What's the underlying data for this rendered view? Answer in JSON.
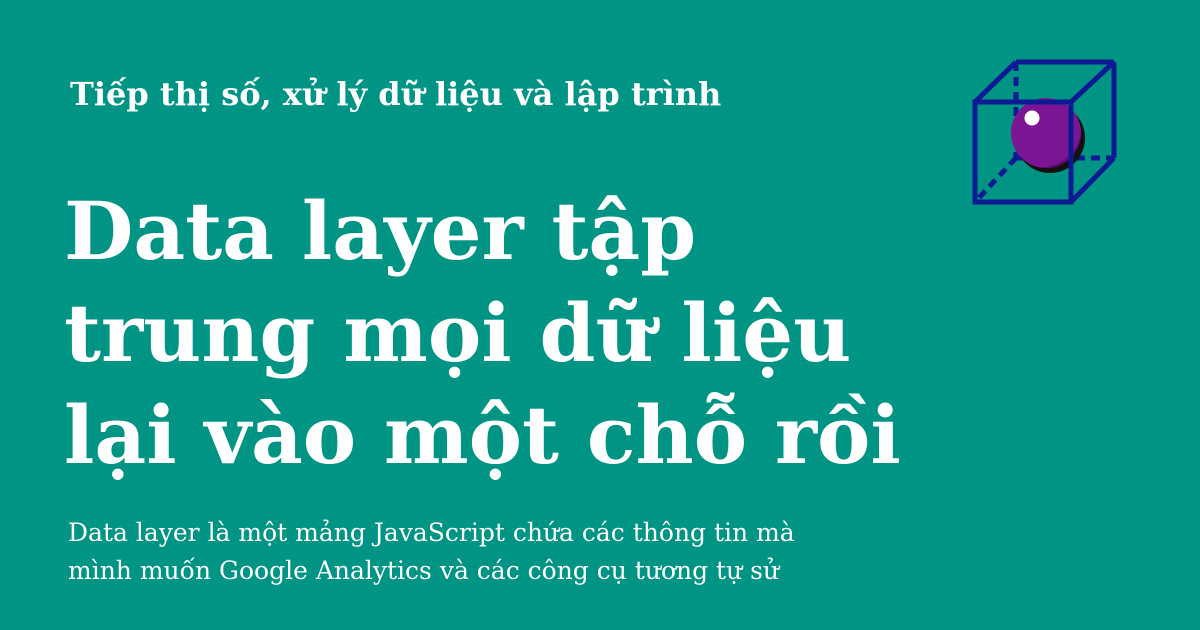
{
  "card": {
    "background_color": "#009485",
    "tagline": "Tiếp thị số, xử lý dữ liệu và lập trình",
    "headline_lines": [
      "Data layer tập",
      "trung mọi dữ liệu",
      "lại vào một chỗ rồi"
    ],
    "description_lines": [
      "Data layer là một mảng JavaScript chứa các thông tin mà",
      "mình muốn Google Analytics và các công cụ tương tự sử"
    ],
    "logo": {
      "icon": "cube-with-sphere-icon",
      "cube_color": "#0d1a94",
      "sphere_color": "#7b1594"
    }
  }
}
